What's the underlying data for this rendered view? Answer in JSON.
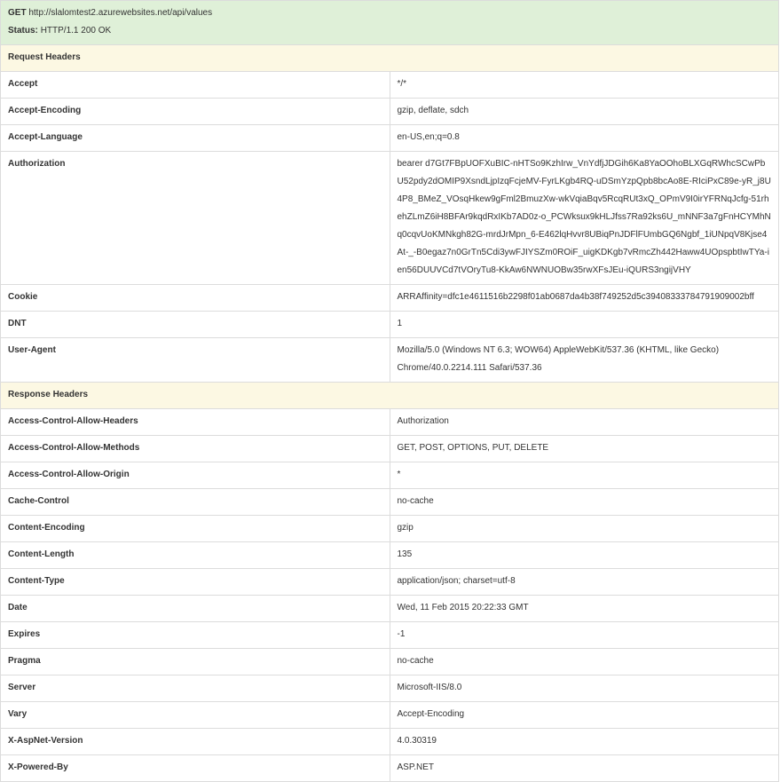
{
  "summary": {
    "method": "GET",
    "url": "http://slalomtest2.azurewebsites.net/api/values",
    "status_label": "Status:",
    "status_value": "HTTP/1.1 200 OK"
  },
  "request_headers": {
    "title": "Request Headers",
    "rows": [
      {
        "key": "Accept",
        "value": "*/*"
      },
      {
        "key": "Accept-Encoding",
        "value": "gzip, deflate, sdch"
      },
      {
        "key": "Accept-Language",
        "value": "en-US,en;q=0.8"
      },
      {
        "key": "Authorization",
        "value": "bearer d7Gt7FBpUOFXuBIC-nHTSo9KzhIrw_VnYdfjJDGih6Ka8YaOOhoBLXGqRWhcSCwPbU52pdy2dOMIP9XsndLjpIzqFcjeMV-FyrLKgb4RQ-uDSmYzpQpb8bcAo8E-RIciPxC89e-yR_j8U4P8_BMeZ_VOsqHkew9gFml2BmuzXw-wkVqiaBqv5RcqRUt3xQ_OPmV9I0irYFRNqJcfg-51rhehZLmZ6iH8BFAr9kqdRxIKb7AD0z-o_PCWksux9kHLJfss7Ra92ks6U_mNNF3a7gFnHCYMhNq0cqvUoKMNkgh82G-mrdJrMpn_6-E462lqHvvr8UBiqPnJDFlFUmbGQ6Ngbf_1iUNpqV8Kjse4At-_-B0egaz7n0GrTn5Cdi3ywFJIYSZm0ROiF_uigKDKgb7vRmcZh442Haww4UOpspbtIwTYa-ien56DUUVCd7tVOryTu8-KkAw6NWNUOBw35rwXFsJEu-iQURS3ngijVHY"
      },
      {
        "key": "Cookie",
        "value": "ARRAffinity=dfc1e4611516b2298f01ab0687da4b38f749252d5c39408333784791909002bff"
      },
      {
        "key": "DNT",
        "value": "1"
      },
      {
        "key": "User-Agent",
        "value": "Mozilla/5.0 (Windows NT 6.3; WOW64) AppleWebKit/537.36 (KHTML, like Gecko) Chrome/40.0.2214.111 Safari/537.36"
      }
    ]
  },
  "response_headers": {
    "title": "Response Headers",
    "rows": [
      {
        "key": "Access-Control-Allow-Headers",
        "value": "Authorization"
      },
      {
        "key": "Access-Control-Allow-Methods",
        "value": "GET, POST, OPTIONS, PUT, DELETE"
      },
      {
        "key": "Access-Control-Allow-Origin",
        "value": "*"
      },
      {
        "key": "Cache-Control",
        "value": "no-cache"
      },
      {
        "key": "Content-Encoding",
        "value": "gzip"
      },
      {
        "key": "Content-Length",
        "value": "135"
      },
      {
        "key": "Content-Type",
        "value": "application/json; charset=utf-8"
      },
      {
        "key": "Date",
        "value": "Wed, 11 Feb 2015 20:22:33 GMT"
      },
      {
        "key": "Expires",
        "value": "-1"
      },
      {
        "key": "Pragma",
        "value": "no-cache"
      },
      {
        "key": "Server",
        "value": "Microsoft-IIS/8.0"
      },
      {
        "key": "Vary",
        "value": "Accept-Encoding"
      },
      {
        "key": "X-AspNet-Version",
        "value": "4.0.30319"
      },
      {
        "key": "X-Powered-By",
        "value": "ASP.NET"
      }
    ]
  },
  "colors": {
    "summary_bg": "#dff0d8",
    "section_bg": "#fcf8e3",
    "border": "#dcdcdc"
  }
}
